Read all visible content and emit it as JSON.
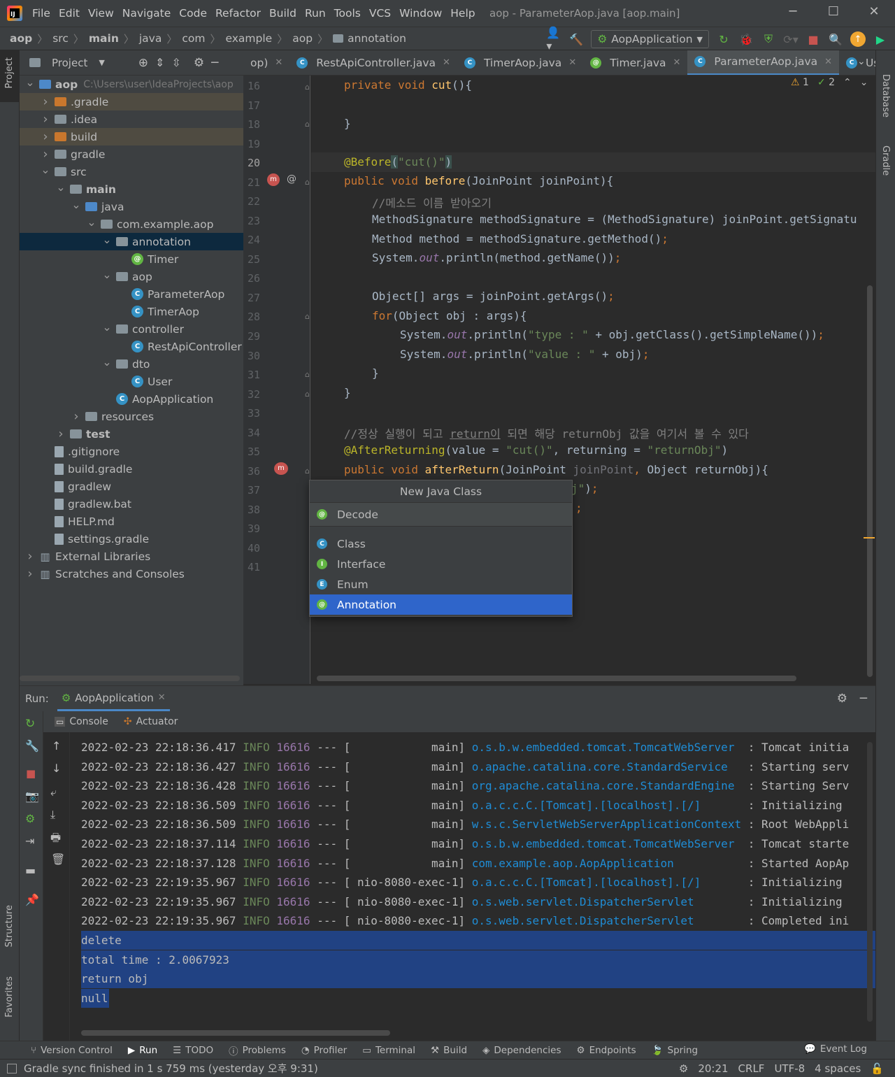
{
  "menu": {
    "items": [
      "File",
      "Edit",
      "View",
      "Navigate",
      "Code",
      "Refactor",
      "Build",
      "Run",
      "Tools",
      "VCS",
      "Window",
      "Help"
    ],
    "window_title": "aop - ParameterAop.java [aop.main]"
  },
  "breadcrumb": [
    "aop",
    "src",
    "main",
    "java",
    "com",
    "example",
    "aop",
    "annotation"
  ],
  "toolbar": {
    "run_config": "AopApplication"
  },
  "project_panel": {
    "title": "Project",
    "tree": [
      {
        "label": "aop",
        "hint": "C:\\Users\\user\\IdeaProjects\\aop",
        "indent": 0,
        "type": "folder-blue",
        "arrow": "down",
        "bold": true
      },
      {
        "label": ".gradle",
        "indent": 1,
        "type": "folder-orange",
        "arrow": "right",
        "excluded": true
      },
      {
        "label": ".idea",
        "indent": 1,
        "type": "folder",
        "arrow": "right"
      },
      {
        "label": "build",
        "indent": 1,
        "type": "folder-orange",
        "arrow": "right",
        "excluded": true
      },
      {
        "label": "gradle",
        "indent": 1,
        "type": "folder",
        "arrow": "right"
      },
      {
        "label": "src",
        "indent": 1,
        "type": "folder",
        "arrow": "down"
      },
      {
        "label": "main",
        "indent": 2,
        "type": "folder",
        "arrow": "down",
        "bold": true
      },
      {
        "label": "java",
        "indent": 3,
        "type": "folder-blue",
        "arrow": "down"
      },
      {
        "label": "com.example.aop",
        "indent": 4,
        "type": "folder",
        "arrow": "down"
      },
      {
        "label": "annotation",
        "indent": 5,
        "type": "folder",
        "arrow": "down",
        "selected": true
      },
      {
        "label": "Timer",
        "indent": 6,
        "type": "annotation",
        "arrow": ""
      },
      {
        "label": "aop",
        "indent": 5,
        "type": "folder",
        "arrow": "down"
      },
      {
        "label": "ParameterAop",
        "indent": 6,
        "type": "class",
        "arrow": ""
      },
      {
        "label": "TimerAop",
        "indent": 6,
        "type": "class",
        "arrow": ""
      },
      {
        "label": "controller",
        "indent": 5,
        "type": "folder",
        "arrow": "down"
      },
      {
        "label": "RestApiController",
        "indent": 6,
        "type": "class",
        "arrow": ""
      },
      {
        "label": "dto",
        "indent": 5,
        "type": "folder",
        "arrow": "down"
      },
      {
        "label": "User",
        "indent": 6,
        "type": "class",
        "arrow": ""
      },
      {
        "label": "AopApplication",
        "indent": 5,
        "type": "class",
        "arrow": ""
      },
      {
        "label": "resources",
        "indent": 3,
        "type": "folder",
        "arrow": "right"
      },
      {
        "label": "test",
        "indent": 2,
        "type": "folder",
        "arrow": "right",
        "bold": true
      },
      {
        "label": ".gitignore",
        "indent": 1,
        "type": "file",
        "arrow": ""
      },
      {
        "label": "build.gradle",
        "indent": 1,
        "type": "file",
        "arrow": ""
      },
      {
        "label": "gradlew",
        "indent": 1,
        "type": "file",
        "arrow": ""
      },
      {
        "label": "gradlew.bat",
        "indent": 1,
        "type": "file",
        "arrow": ""
      },
      {
        "label": "HELP.md",
        "indent": 1,
        "type": "file",
        "arrow": ""
      },
      {
        "label": "settings.gradle",
        "indent": 1,
        "type": "file",
        "arrow": ""
      },
      {
        "label": "External Libraries",
        "indent": 0,
        "type": "lib",
        "arrow": "right"
      },
      {
        "label": "Scratches and Consoles",
        "indent": 0,
        "type": "lib",
        "arrow": "right"
      }
    ]
  },
  "editor_tabs": [
    {
      "label": "op)",
      "icon": ""
    },
    {
      "label": "RestApiController.java",
      "icon": "C"
    },
    {
      "label": "TimerAop.java",
      "icon": "C"
    },
    {
      "label": "Timer.java",
      "icon": "@"
    },
    {
      "label": "ParameterAop.java",
      "icon": "C",
      "active": true
    },
    {
      "label": "User.java",
      "icon": "C"
    }
  ],
  "inspections": {
    "warnings": "1",
    "ok": "2"
  },
  "line_numbers": [
    "16",
    "17",
    "18",
    "19",
    "20",
    "21",
    "22",
    "23",
    "24",
    "25",
    "26",
    "27",
    "28",
    "29",
    "30",
    "31",
    "32",
    "33",
    "34",
    "35",
    "36",
    "37",
    "38",
    "39",
    "40",
    "41"
  ],
  "popup": {
    "title": "New Java Class",
    "input_value": "Decode",
    "items": [
      {
        "label": "Class",
        "icon": "C",
        "color": "#3592c4"
      },
      {
        "label": "Interface",
        "icon": "I",
        "color": "#62b543"
      },
      {
        "label": "Enum",
        "icon": "E",
        "color": "#3592c4"
      },
      {
        "label": "Annotation",
        "icon": "@",
        "color": "#62b543",
        "selected": true
      }
    ]
  },
  "run_panel": {
    "label": "Run:",
    "tab": "AopApplication",
    "subtabs": [
      "Console",
      "Actuator"
    ],
    "log_lines": [
      {
        "ts": "2022-02-23 22:18:36.417",
        "lv": "INFO",
        "pid": "16616",
        "sep": "--- [",
        "thread": "           main]",
        "logger": "o.s.b.w.embedded.tomcat.TomcatWebServer",
        "msg": ": Tomcat initia"
      },
      {
        "ts": "2022-02-23 22:18:36.427",
        "lv": "INFO",
        "pid": "16616",
        "sep": "--- [",
        "thread": "           main]",
        "logger": "o.apache.catalina.core.StandardService",
        "msg": ": Starting serv"
      },
      {
        "ts": "2022-02-23 22:18:36.428",
        "lv": "INFO",
        "pid": "16616",
        "sep": "--- [",
        "thread": "           main]",
        "logger": "org.apache.catalina.core.StandardEngine",
        "msg": ": Starting Serv"
      },
      {
        "ts": "2022-02-23 22:18:36.509",
        "lv": "INFO",
        "pid": "16616",
        "sep": "--- [",
        "thread": "           main]",
        "logger": "o.a.c.c.C.[Tomcat].[localhost].[/]",
        "msg": ": Initializing"
      },
      {
        "ts": "2022-02-23 22:18:36.509",
        "lv": "INFO",
        "pid": "16616",
        "sep": "--- [",
        "thread": "           main]",
        "logger": "w.s.c.ServletWebServerApplicationContext",
        "msg": ": Root WebAppli"
      },
      {
        "ts": "2022-02-23 22:18:37.114",
        "lv": "INFO",
        "pid": "16616",
        "sep": "--- [",
        "thread": "           main]",
        "logger": "o.s.b.w.embedded.tomcat.TomcatWebServer",
        "msg": ": Tomcat starte"
      },
      {
        "ts": "2022-02-23 22:18:37.128",
        "lv": "INFO",
        "pid": "16616",
        "sep": "--- [",
        "thread": "           main]",
        "logger": "com.example.aop.AopApplication",
        "msg": ": Started AopAp"
      },
      {
        "ts": "2022-02-23 22:19:35.967",
        "lv": "INFO",
        "pid": "16616",
        "sep": "--- [",
        "thread": "nio-8080-exec-1]",
        "logger": "o.a.c.c.C.[Tomcat].[localhost].[/]",
        "msg": ": Initializing"
      },
      {
        "ts": "2022-02-23 22:19:35.967",
        "lv": "INFO",
        "pid": "16616",
        "sep": "--- [",
        "thread": "nio-8080-exec-1]",
        "logger": "o.s.web.servlet.DispatcherServlet",
        "msg": ": Initializing"
      },
      {
        "ts": "2022-02-23 22:19:35.967",
        "lv": "INFO",
        "pid": "16616",
        "sep": "--- [",
        "thread": "nio-8080-exec-1]",
        "logger": "o.s.web.servlet.DispatcherServlet",
        "msg": ": Completed ini"
      }
    ],
    "output_lines": [
      "delete",
      "total time : 2.0067923",
      "return obj",
      "null"
    ]
  },
  "bottom_tools": [
    "Version Control",
    "Run",
    "TODO",
    "Problems",
    "Profiler",
    "Terminal",
    "Build",
    "Dependencies",
    "Endpoints",
    "Spring"
  ],
  "event_log": "Event Log",
  "status": {
    "message": "Gradle sync finished in 1 s 759 ms (yesterday 오후 9:31)",
    "position": "20:21",
    "line_sep": "CRLF",
    "encoding": "UTF-8",
    "indent": "4 spaces"
  },
  "side_labels": {
    "project": "Project",
    "structure": "Structure",
    "favorites": "Favorites",
    "database": "Database",
    "gradle": "Gradle"
  }
}
